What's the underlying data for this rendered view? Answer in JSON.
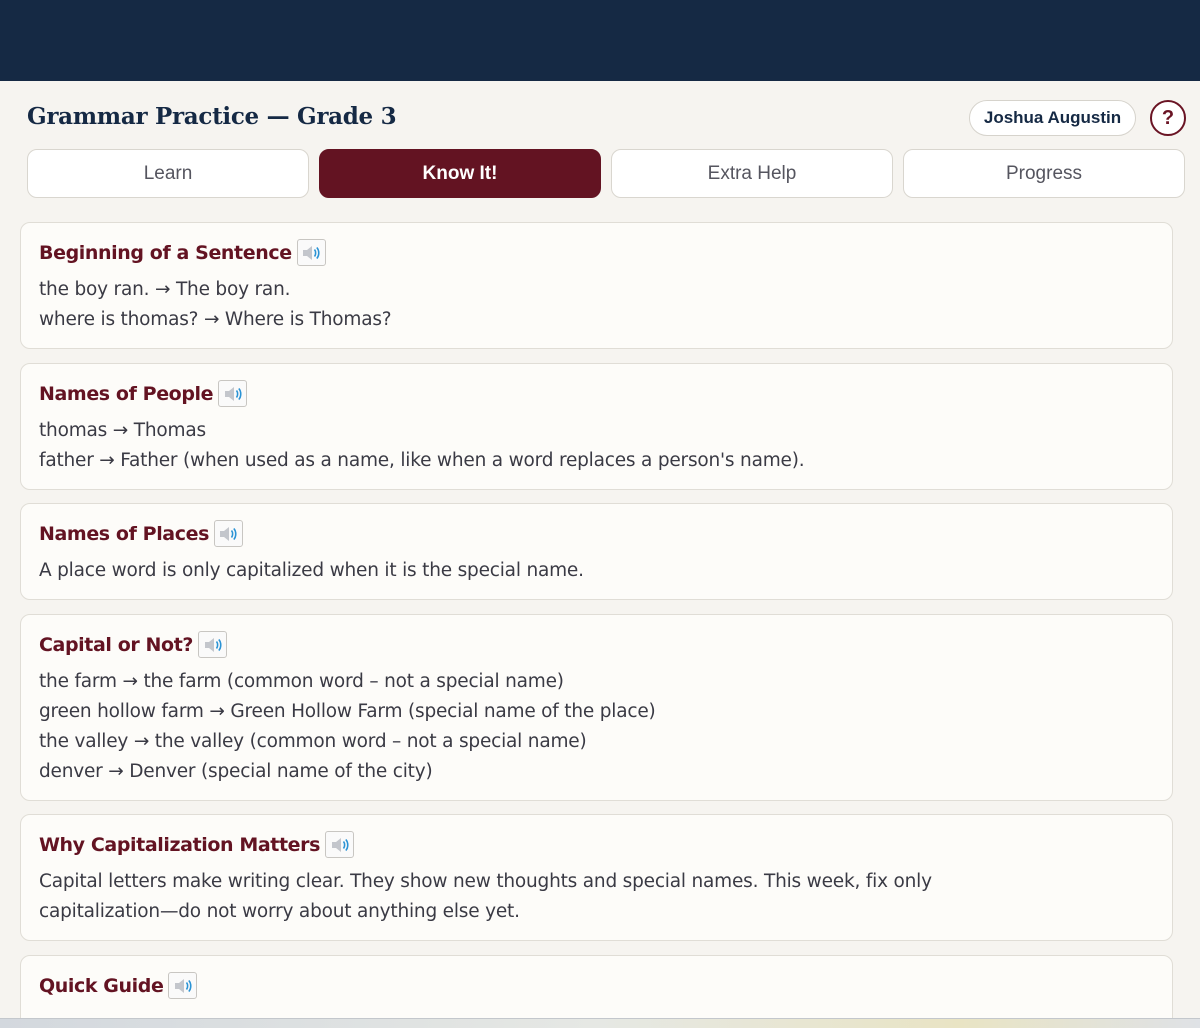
{
  "header": {
    "title": "Grammar Practice — Grade 3",
    "user_name": "Joshua Augustin",
    "help_label": "?"
  },
  "tabs": [
    {
      "label": "Learn",
      "active": false
    },
    {
      "label": "Know It!",
      "active": true
    },
    {
      "label": "Extra Help",
      "active": false
    },
    {
      "label": "Progress",
      "active": false
    }
  ],
  "cards": [
    {
      "title": "Beginning of a Sentence",
      "lines": [
        "the boy ran. → The boy ran.",
        "where is thomas? → Where is Thomas?"
      ]
    },
    {
      "title": "Names of People",
      "lines": [
        "thomas → Thomas",
        "father → Father (when used as a name, like when a word replaces a person's name)."
      ]
    },
    {
      "title": "Names of Places",
      "lines": [
        "A place word is only capitalized when it is the special name."
      ]
    },
    {
      "title": "Capital or Not?",
      "lines": [
        "the farm → the farm (common word – not a special name)",
        "green hollow farm → Green Hollow Farm (special name of the place)",
        "the valley → the valley (common word – not a special name)",
        "denver → Denver (special name of the city)"
      ]
    },
    {
      "title": "Why Capitalization Matters",
      "lines": [
        "Capital letters make writing clear. They show new thoughts and special names. This week, fix only",
        "capitalization—do not worry about anything else yet."
      ]
    },
    {
      "title": "Quick Guide",
      "lines": []
    }
  ],
  "icons": {
    "speaker": "speaker-icon",
    "help": "question-mark-icon"
  },
  "colors": {
    "topbar": "#152944",
    "accent": "#631322",
    "background": "#f6f4f0",
    "card": "#fdfcf9"
  }
}
